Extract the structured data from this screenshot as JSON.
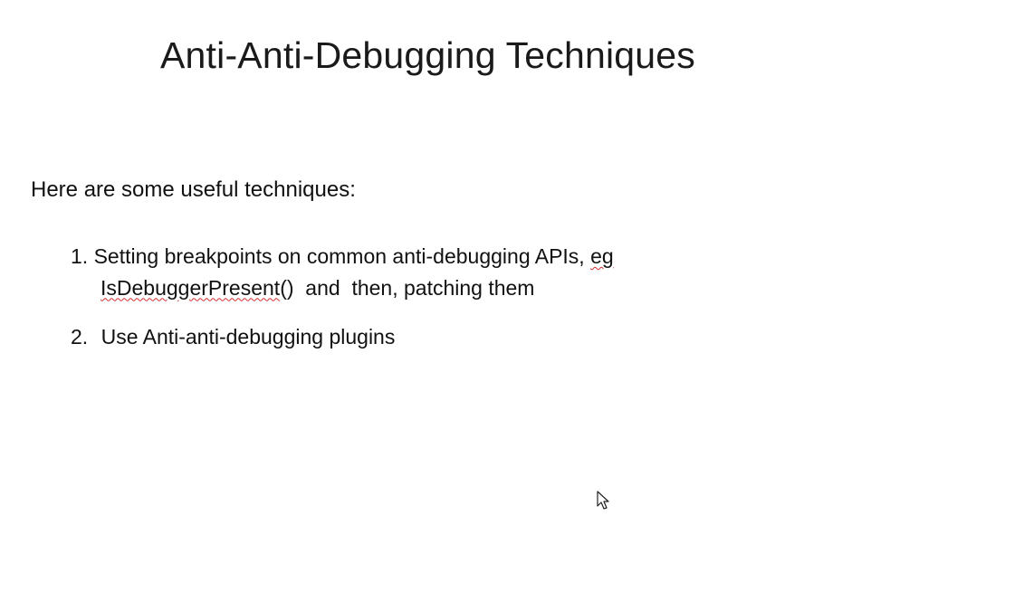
{
  "slide": {
    "title": "Anti-Anti-Debugging Techniques",
    "intro": "Here are some useful techniques:",
    "items": [
      {
        "number": "1.",
        "line1_text": "Setting breakpoints on common anti-debugging APIs,",
        "line1_flagged": "eg",
        "line2_flagged": "IsDebuggerPresent",
        "line2_rest": "()  and  then, patching them"
      },
      {
        "number": "2.",
        "text": "Use Anti-anti-debugging plugins"
      }
    ]
  },
  "icons": {
    "cursor": "mouse-pointer-icon"
  }
}
